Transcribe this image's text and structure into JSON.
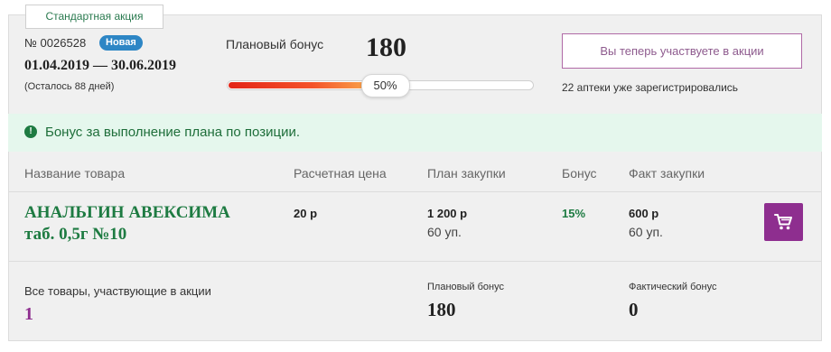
{
  "promo": {
    "tag": "Стандартная акция",
    "number": "№ 0026528",
    "status_badge": "Новая",
    "dates": "01.04.2019 — 30.06.2019",
    "remaining": "(Осталось 88 дней)"
  },
  "plan": {
    "label": "Плановый бонус",
    "value": "180",
    "progress_label": "50%",
    "progress_fraction": 0.5
  },
  "participation": {
    "button_label": "Вы теперь участвуете в акции",
    "registered_text": "22 аптеки уже зарегистрировались"
  },
  "notice": {
    "icon": "exclamation-icon",
    "text": "Бонус за выполнение плана по позиции."
  },
  "table": {
    "headers": [
      "Название товара",
      "Расчетная цена",
      "План закупки",
      "Бонус",
      "Факт закупки"
    ],
    "row": {
      "name_line1": "АНАЛЬГИН АВЕКСИМА",
      "name_line2": "таб. 0,5г №10",
      "price": "20 р",
      "plan_amount": "1 200 р",
      "plan_units": "60 уп.",
      "bonus": "15%",
      "fact_amount": "600 р",
      "fact_units": "60 уп.",
      "cart_icon": "cart-icon"
    }
  },
  "footer": {
    "all_items_label": "Все товары, участвующие в акции",
    "all_items_count": "1",
    "plan_bonus_label": "Плановый бонус",
    "plan_bonus_value": "180",
    "fact_bonus_label": "Фактический бонус",
    "fact_bonus_value": "0"
  },
  "colors": {
    "accent_green": "#1e7b42",
    "accent_purple": "#8e2e8f",
    "badge_blue": "#2d86c5"
  }
}
